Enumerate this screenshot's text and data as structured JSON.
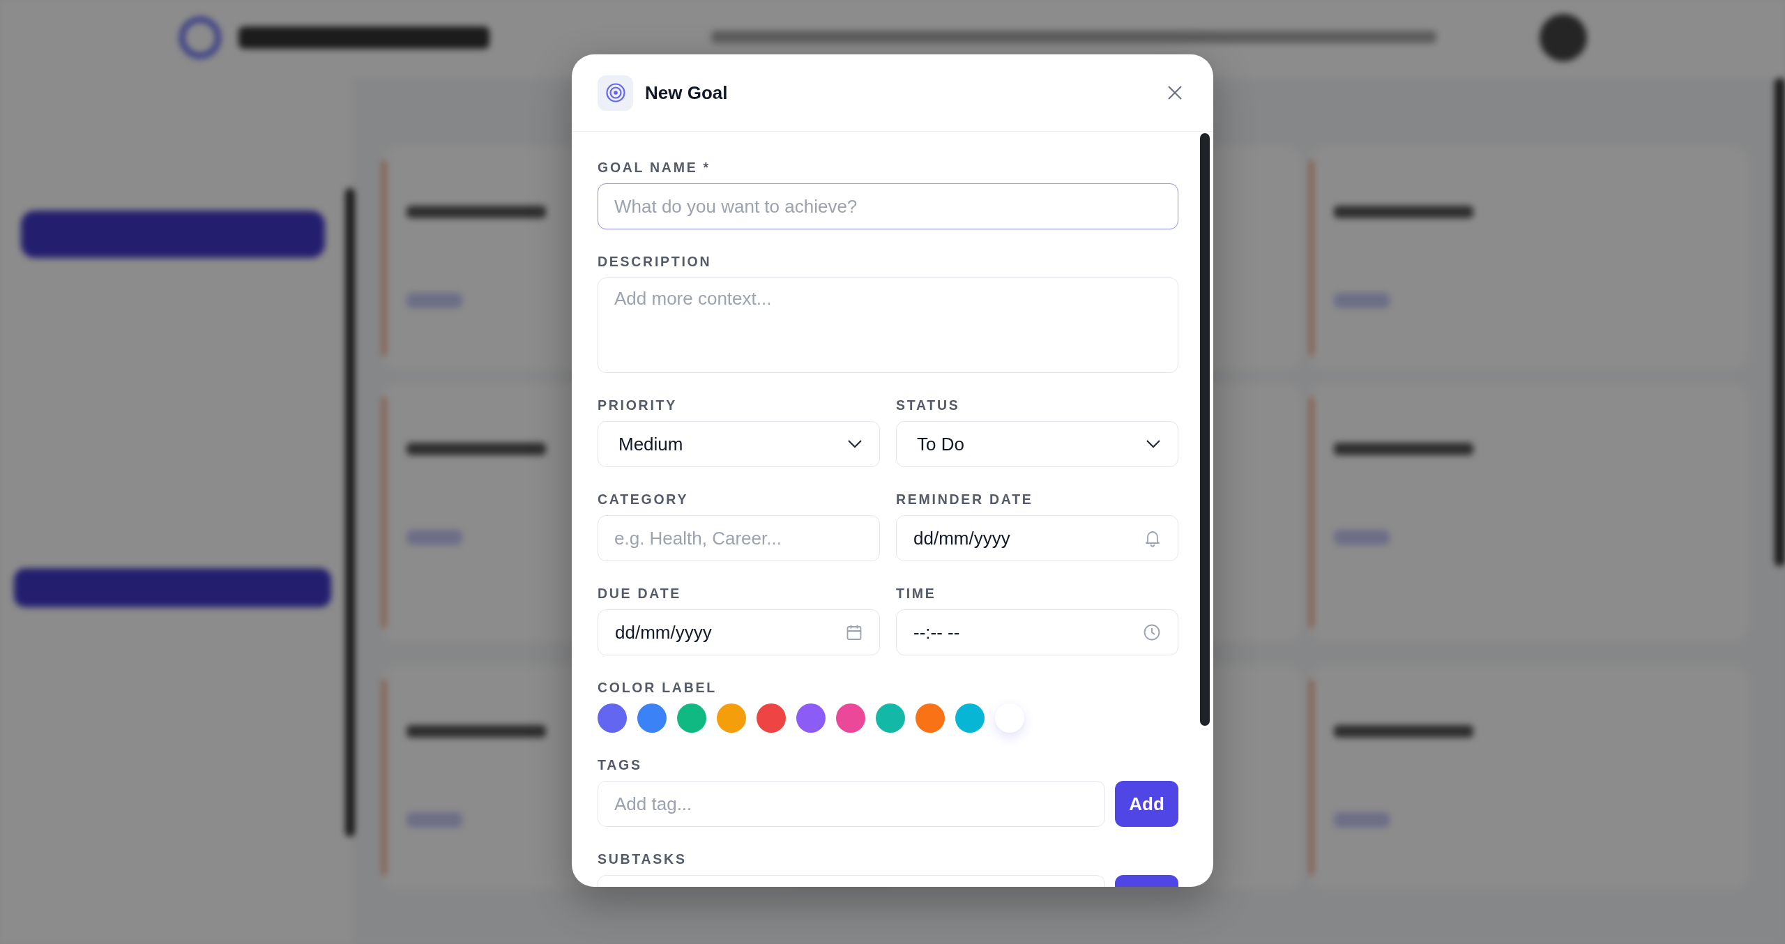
{
  "modal": {
    "title": "New Goal",
    "rows": [
      {
        "fields": [
          {
            "label": "GOAL NAME *",
            "kind": "text",
            "placeholder": "What do you want to achieve?",
            "focused": true
          }
        ]
      },
      {
        "fields": [
          {
            "label": "DESCRIPTION",
            "kind": "textarea",
            "placeholder": "Add more context...",
            "focused": false
          }
        ]
      },
      {
        "fields": [
          {
            "label": "PRIORITY",
            "kind": "select",
            "value": "Medium"
          },
          {
            "label": "STATUS",
            "kind": "select",
            "value": "To Do"
          }
        ]
      },
      {
        "fields": [
          {
            "label": "CATEGORY",
            "kind": "text",
            "placeholder": "e.g. Health, Career...",
            "focused": false
          },
          {
            "label": "REMINDER DATE",
            "kind": "reminder",
            "value": "dd/mm/yyyy"
          }
        ]
      },
      {
        "fields": [
          {
            "label": "DUE DATE",
            "kind": "date",
            "value": "dd/mm/yyyy"
          },
          {
            "label": "TIME",
            "kind": "time",
            "value": "--:-- --"
          }
        ]
      },
      {
        "fields": [
          {
            "label": "COLOR LABEL",
            "kind": "colors",
            "colors": [
              {
                "color": "#6366f1"
              },
              {
                "color": "#3b82f6"
              },
              {
                "color": "#10b981"
              },
              {
                "color": "#f59e0b"
              },
              {
                "color": "#ef4444"
              },
              {
                "color": "#8b5cf6"
              },
              {
                "color": "#ec4899"
              },
              {
                "color": "#14b8a6"
              },
              {
                "color": "#f97316"
              },
              {
                "color": "#06b6d4"
              },
              {
                "color": "#ffffff"
              }
            ]
          }
        ]
      },
      {
        "fields": [
          {
            "label": "TAGS",
            "kind": "add",
            "placeholder": "Add tag...",
            "button": "Add"
          }
        ]
      },
      {
        "fields": [
          {
            "label": "SUBTASKS",
            "kind": "add"
          }
        ]
      }
    ]
  }
}
